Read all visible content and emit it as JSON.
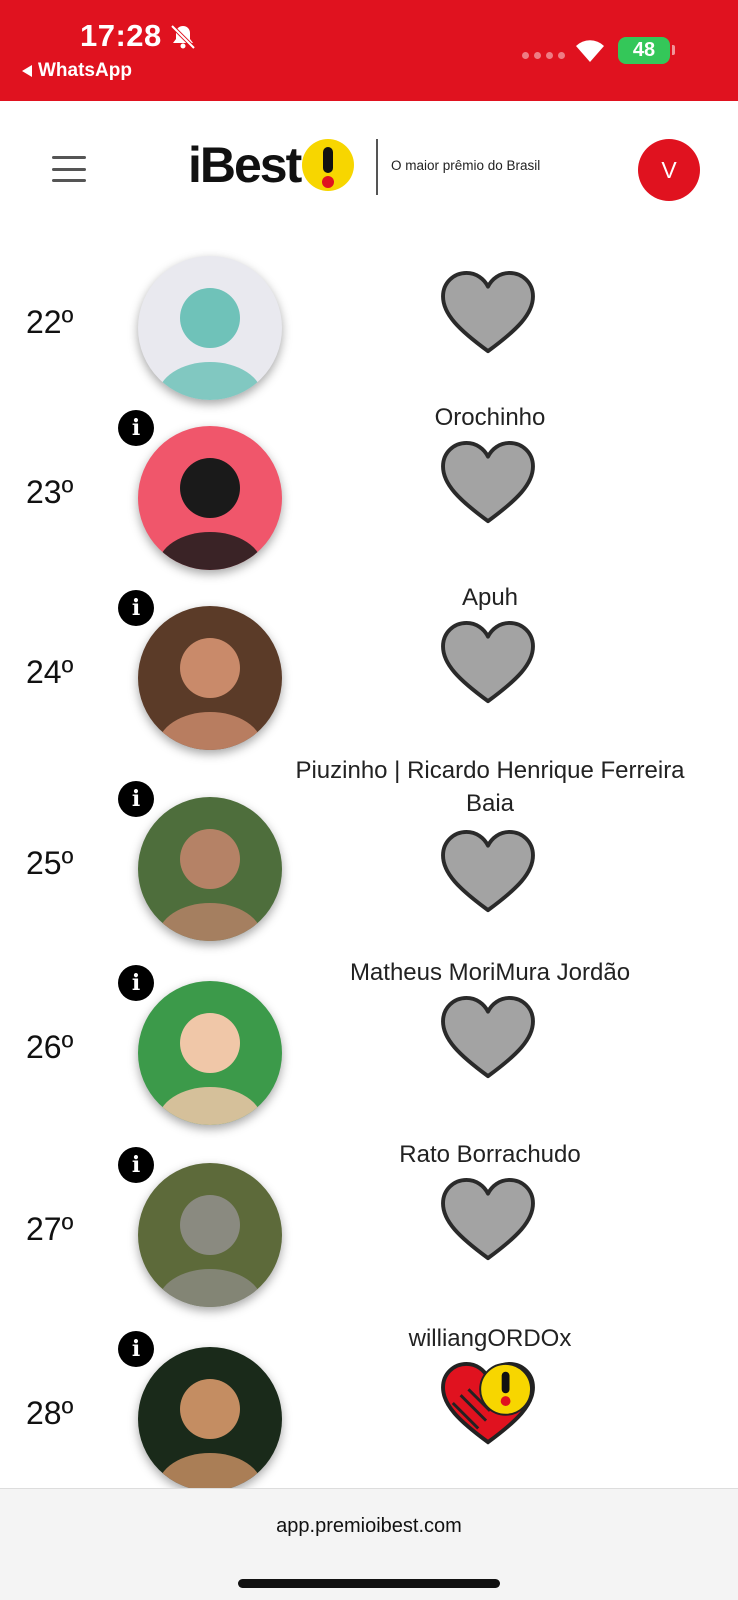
{
  "status_bar": {
    "time": "17:28",
    "back_app": "WhatsApp",
    "battery": "48",
    "color": "#e0121f"
  },
  "header": {
    "logo_text": "iBest",
    "tagline": "O maior prêmio do Brasil",
    "avatar_initial": "V"
  },
  "ranking": [
    {
      "rank": "22º",
      "name": "",
      "voted": false,
      "photo": {
        "bg": "#e9e9ef",
        "accent": "#6fc2b9"
      }
    },
    {
      "rank": "23º",
      "name": "Orochinho",
      "voted": false,
      "photo": {
        "bg": "#f0566b",
        "accent": "#1a1a1a"
      }
    },
    {
      "rank": "24º",
      "name": "Apuh",
      "voted": false,
      "photo": {
        "bg": "#5b3b28",
        "accent": "#c98a6a"
      }
    },
    {
      "rank": "25º",
      "name": "Piuzinho | Ricardo Henrique Ferreira Baia",
      "voted": false,
      "photo": {
        "bg": "#4e6e3c",
        "accent": "#b58266"
      }
    },
    {
      "rank": "26º",
      "name": "Matheus MoriMura Jordão",
      "voted": false,
      "photo": {
        "bg": "#3c9a4a",
        "accent": "#f0c7a8"
      }
    },
    {
      "rank": "27º",
      "name": "Rato Borrachudo",
      "voted": false,
      "photo": {
        "bg": "#5d6a3a",
        "accent": "#8a8a80"
      }
    },
    {
      "rank": "28º",
      "name": "williangORDOx",
      "voted": true,
      "photo": {
        "bg": "#1a2a1a",
        "accent": "#c48d62"
      }
    }
  ],
  "bottom_bar": {
    "url": "app.premioibest.com"
  }
}
